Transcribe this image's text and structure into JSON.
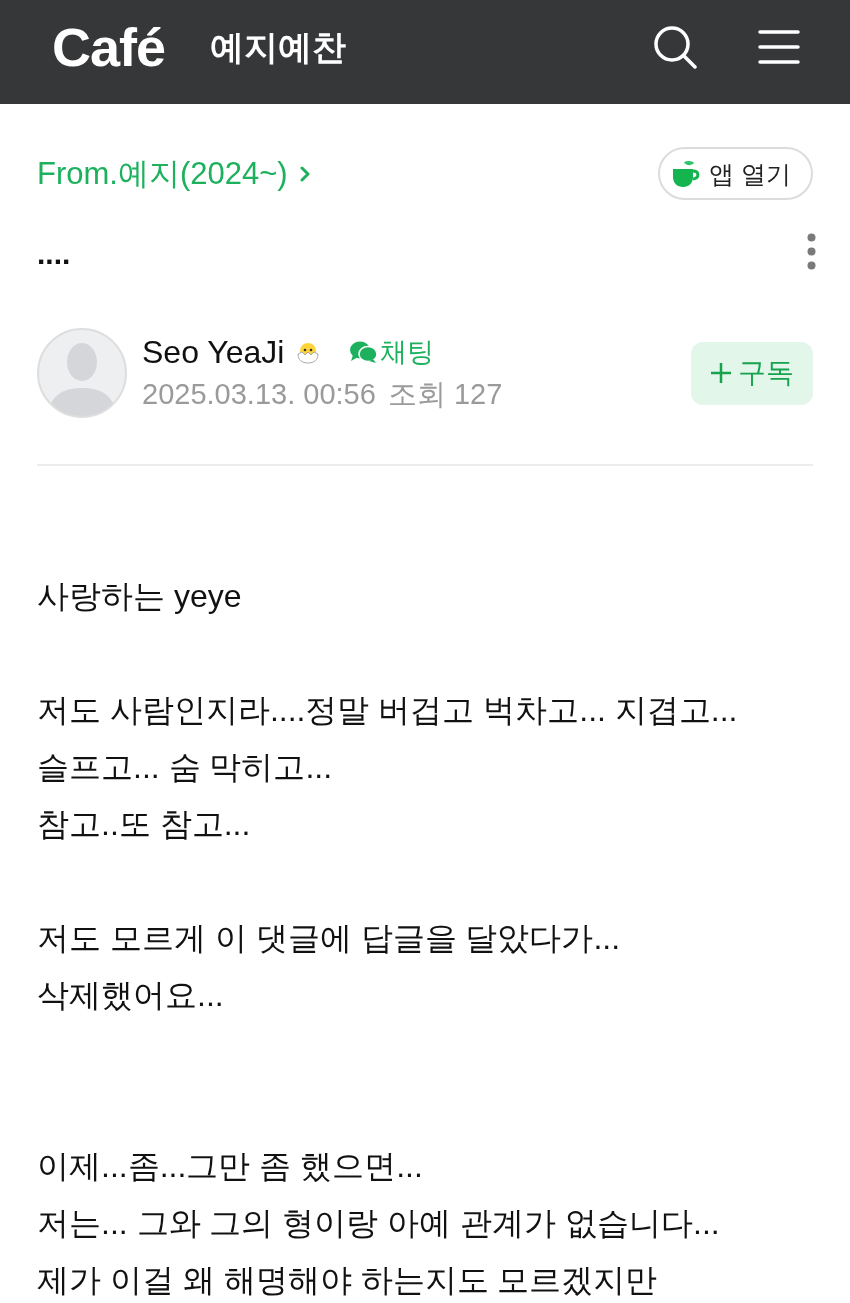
{
  "header": {
    "logo": "Café",
    "title": "예지예찬"
  },
  "board_link": {
    "label": "From.예지(2024~)"
  },
  "app_button": {
    "label": "앱 열기"
  },
  "post": {
    "title": "....",
    "author": {
      "name": "Seo YeaJi",
      "chat_label": "채팅",
      "date": "2025.03.13. 00:56",
      "views": "조회 127"
    },
    "subscribe_button": {
      "label": "구독"
    }
  },
  "body": {
    "sections": [
      {
        "paragraphs": [
          {
            "lines": [
              "사랑하는 yeye"
            ]
          },
          {
            "lines": [
              "저도 사람인지라....정말 버겁고 벅차고... 지겹고...",
              "슬프고... 숨 막히고...",
              "참고..또 참고..."
            ]
          },
          {
            "lines": [
              "저도 모르게 이 댓글에 답글을 달았다가...",
              "삭제했어요..."
            ]
          }
        ]
      },
      {
        "paragraphs": [
          {
            "lines": [
              "이제...좀...그만 좀 했으면...",
              "저는... 그와 그의 형이랑 아예 관계가 없습니다...",
              "제가 이걸 왜 해명해야 하는지도 모르겠지만"
            ]
          }
        ]
      }
    ]
  }
}
